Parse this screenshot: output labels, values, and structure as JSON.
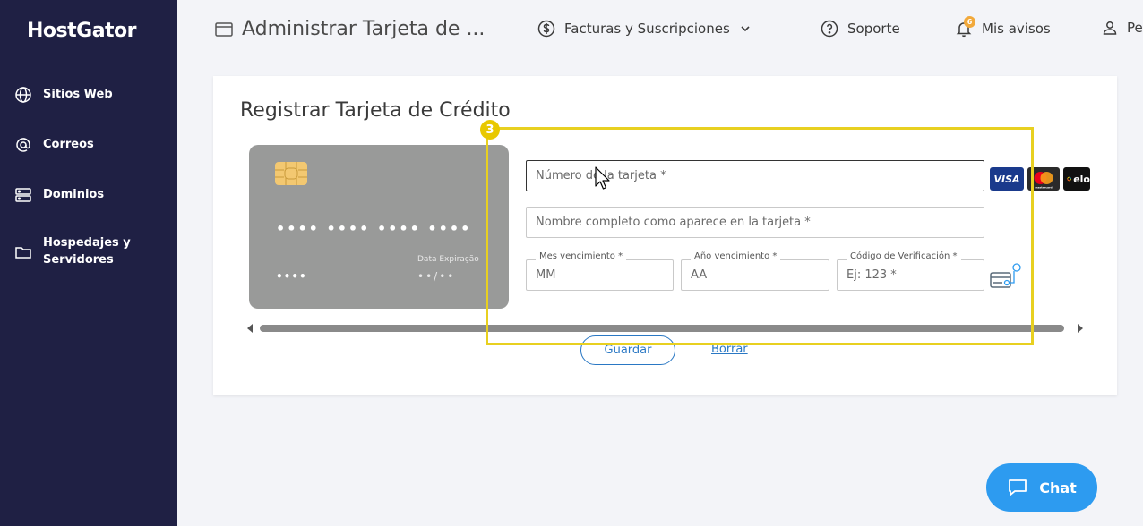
{
  "app": {
    "logo": "HostGator"
  },
  "sidebar": {
    "items": [
      {
        "label": "Sitios Web",
        "icon": "globe-icon"
      },
      {
        "label": "Correos",
        "icon": "at-icon"
      },
      {
        "label": "Dominios",
        "icon": "server-icon"
      },
      {
        "label": "Hospedajes y Servidores",
        "icon": "folder-icon"
      }
    ]
  },
  "topbar": {
    "page_title": "Administrar Tarjeta de ...",
    "billing": "Facturas y Suscripciones",
    "support": "Soporte",
    "notifications": "Mis avisos",
    "notifications_count": "6",
    "profile": "Pe"
  },
  "form": {
    "title": "Registrar Tarjeta de Crédito",
    "card_preview": {
      "number_mask": "•••• •••• •••• ••••",
      "short_mask": "••••",
      "exp_label": "Data Expiração",
      "exp_mask": "••/••"
    },
    "card_number_placeholder": "Número de la tarjeta *",
    "full_name_placeholder": "Nombre completo como aparece en la tarjeta *",
    "month_label": "Mes vencimiento *",
    "month_placeholder": "MM",
    "year_label": "Año vencimiento *",
    "year_placeholder": "AA",
    "cvv_label": "Código de Verificación *",
    "cvv_placeholder": "Ej: 123 *",
    "brands": [
      "VISA",
      "mastercard",
      "elo"
    ],
    "save_label": "Guardar",
    "clear_label": "Borrar"
  },
  "overlay": {
    "step_number": "3",
    "color": "#e8d020"
  },
  "chat": {
    "label": "Chat"
  },
  "colors": {
    "sidebar": "#1f2044",
    "accent": "#2a78c4",
    "chat": "#2d9bf0"
  }
}
